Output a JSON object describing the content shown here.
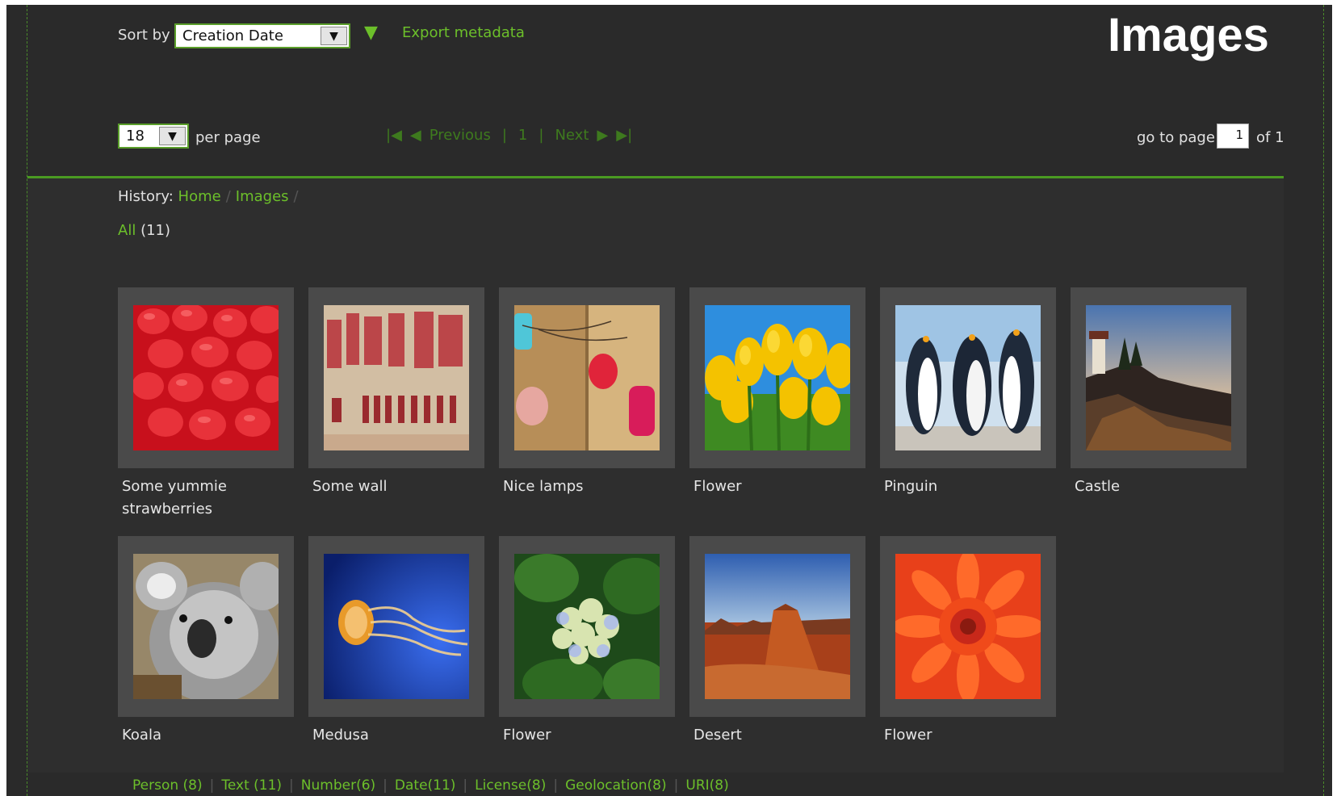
{
  "header": {
    "sort_label": "Sort by",
    "sort_value": "Creation Date",
    "export_label": "Export metadata",
    "title": "Images"
  },
  "paging": {
    "per_page_value": "18",
    "per_page_label": "per page",
    "previous_label": "Previous",
    "current_page": "1",
    "next_label": "Next",
    "goto_label": "go to page",
    "goto_value": "1",
    "of_label": "of 1"
  },
  "history": {
    "label": "History:",
    "crumbs": [
      "Home",
      "Images"
    ]
  },
  "filter": {
    "all_label": "All",
    "all_count": "(11)"
  },
  "images": [
    {
      "caption": "Some yummie strawberries",
      "icon": "strawberries-photo"
    },
    {
      "caption": "Some wall",
      "icon": "wall-photo"
    },
    {
      "caption": "Nice lamps",
      "icon": "lamps-photo"
    },
    {
      "caption": "Flower",
      "icon": "tulips-photo"
    },
    {
      "caption": "Pinguin",
      "icon": "penguins-photo"
    },
    {
      "caption": "Castle",
      "icon": "lighthouse-photo"
    },
    {
      "caption": "Koala",
      "icon": "koala-photo"
    },
    {
      "caption": "Medusa",
      "icon": "jellyfish-photo"
    },
    {
      "caption": "Flower",
      "icon": "hydrangea-photo"
    },
    {
      "caption": "Desert",
      "icon": "desert-photo"
    },
    {
      "caption": "Flower",
      "icon": "chrysanthemum-photo"
    }
  ],
  "footer_tags": [
    "Person (8)",
    "Text (11)",
    "Number(6)",
    "Date(11)",
    "License(8)",
    "Geolocation(8)",
    "URI(8)"
  ],
  "colors": {
    "accent": "#6cbf2a",
    "background": "#2a2a2a",
    "tile": "#4a4a4a"
  }
}
